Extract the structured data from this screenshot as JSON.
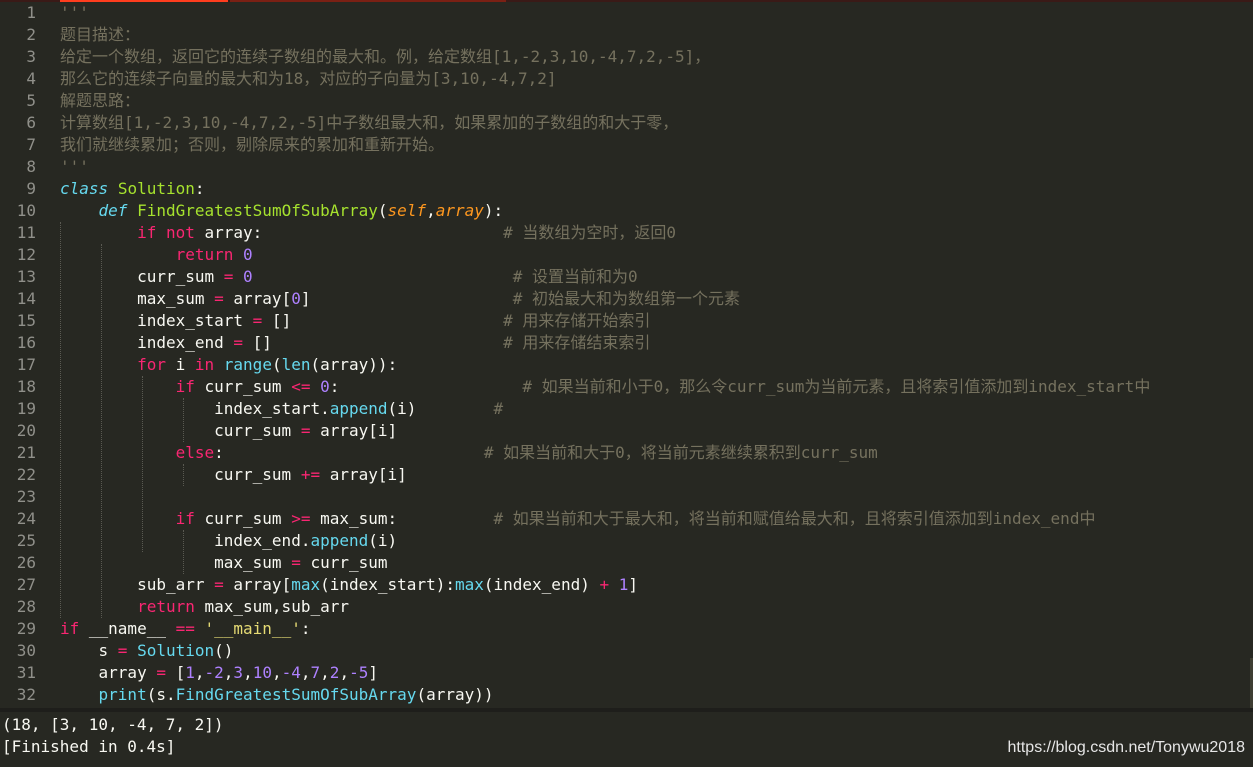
{
  "editor": {
    "lines": [
      {
        "n": "1",
        "tokens": [
          {
            "t": "'''",
            "c": "c-com"
          }
        ]
      },
      {
        "n": "2",
        "tokens": [
          {
            "t": "题目描述：",
            "c": "c-com"
          }
        ]
      },
      {
        "n": "3",
        "tokens": [
          {
            "t": "给定一个数组，返回它的连续子数组的最大和。例，给定数组[1,-2,3,10,-4,7,2,-5]，",
            "c": "c-com"
          }
        ]
      },
      {
        "n": "4",
        "tokens": [
          {
            "t": "那么它的连续子向量的最大和为18，对应的子向量为[3,10,-4,7,2]",
            "c": "c-com"
          }
        ]
      },
      {
        "n": "5",
        "tokens": [
          {
            "t": "解题思路：",
            "c": "c-com"
          }
        ]
      },
      {
        "n": "6",
        "tokens": [
          {
            "t": "计算数组[1,-2,3,10,-4,7,2,-5]中子数组最大和，如果累加的子数组的和大于零，",
            "c": "c-com"
          }
        ]
      },
      {
        "n": "7",
        "tokens": [
          {
            "t": "我们就继续累加；否则，剔除原来的累加和重新开始。",
            "c": "c-com"
          }
        ]
      },
      {
        "n": "8",
        "tokens": [
          {
            "t": "'''",
            "c": "c-com"
          }
        ]
      },
      {
        "n": "9",
        "tokens": [
          {
            "t": "class",
            "c": "c-st"
          },
          {
            "t": " "
          },
          {
            "t": "Solution",
            "c": "c-fn"
          },
          {
            "t": ":"
          }
        ]
      },
      {
        "n": "10",
        "tokens": [
          {
            "t": "    "
          },
          {
            "t": "def",
            "c": "c-st"
          },
          {
            "t": " "
          },
          {
            "t": "FindGreatestSumOfSubArray",
            "c": "c-fn"
          },
          {
            "t": "("
          },
          {
            "t": "self",
            "c": "c-pa"
          },
          {
            "t": ","
          },
          {
            "t": "array",
            "c": "c-pa"
          },
          {
            "t": "):"
          }
        ]
      },
      {
        "n": "11",
        "tokens": [
          {
            "t": "        "
          },
          {
            "t": "if",
            "c": "c-kw"
          },
          {
            "t": " "
          },
          {
            "t": "not",
            "c": "c-kw"
          },
          {
            "t": " array:                         "
          },
          {
            "t": "# 当数组为空时，返回0",
            "c": "c-com"
          }
        ]
      },
      {
        "n": "12",
        "tokens": [
          {
            "t": "            "
          },
          {
            "t": "return",
            "c": "c-kw"
          },
          {
            "t": " "
          },
          {
            "t": "0",
            "c": "c-nu"
          }
        ]
      },
      {
        "n": "13",
        "tokens": [
          {
            "t": "        curr_sum "
          },
          {
            "t": "=",
            "c": "c-kw"
          },
          {
            "t": " "
          },
          {
            "t": "0",
            "c": "c-nu"
          },
          {
            "t": "                           "
          },
          {
            "t": "# 设置当前和为0",
            "c": "c-com"
          }
        ]
      },
      {
        "n": "14",
        "tokens": [
          {
            "t": "        max_sum "
          },
          {
            "t": "=",
            "c": "c-kw"
          },
          {
            "t": " array["
          },
          {
            "t": "0",
            "c": "c-nu"
          },
          {
            "t": "]                     "
          },
          {
            "t": "# 初始最大和为数组第一个元素",
            "c": "c-com"
          }
        ]
      },
      {
        "n": "15",
        "tokens": [
          {
            "t": "        index_start "
          },
          {
            "t": "=",
            "c": "c-kw"
          },
          {
            "t": " []                      "
          },
          {
            "t": "# 用来存储开始索引",
            "c": "c-com"
          }
        ]
      },
      {
        "n": "16",
        "tokens": [
          {
            "t": "        index_end "
          },
          {
            "t": "=",
            "c": "c-kw"
          },
          {
            "t": " []                        "
          },
          {
            "t": "# 用来存储结束索引",
            "c": "c-com"
          }
        ]
      },
      {
        "n": "17",
        "tokens": [
          {
            "t": "        "
          },
          {
            "t": "for",
            "c": "c-kw"
          },
          {
            "t": " i "
          },
          {
            "t": "in",
            "c": "c-kw"
          },
          {
            "t": " "
          },
          {
            "t": "range",
            "c": "c-bi"
          },
          {
            "t": "("
          },
          {
            "t": "len",
            "c": "c-bi"
          },
          {
            "t": "(array)):"
          }
        ]
      },
      {
        "n": "18",
        "tokens": [
          {
            "t": "            "
          },
          {
            "t": "if",
            "c": "c-kw"
          },
          {
            "t": " curr_sum "
          },
          {
            "t": "<=",
            "c": "c-kw"
          },
          {
            "t": " "
          },
          {
            "t": "0",
            "c": "c-nu"
          },
          {
            "t": ":                   "
          },
          {
            "t": "# 如果当前和小于0，那么令curr_sum为当前元素，且将索引值添加到index_start中",
            "c": "c-com"
          }
        ]
      },
      {
        "n": "19",
        "tokens": [
          {
            "t": "                index_start."
          },
          {
            "t": "append",
            "c": "c-bi"
          },
          {
            "t": "(i)        "
          },
          {
            "t": "#",
            "c": "c-com"
          }
        ]
      },
      {
        "n": "20",
        "tokens": [
          {
            "t": "                curr_sum "
          },
          {
            "t": "=",
            "c": "c-kw"
          },
          {
            "t": " array[i]"
          }
        ]
      },
      {
        "n": "21",
        "tokens": [
          {
            "t": "            "
          },
          {
            "t": "else",
            "c": "c-kw"
          },
          {
            "t": ":                           "
          },
          {
            "t": "# 如果当前和大于0，将当前元素继续累积到curr_sum",
            "c": "c-com"
          }
        ]
      },
      {
        "n": "22",
        "tokens": [
          {
            "t": "                curr_sum "
          },
          {
            "t": "+=",
            "c": "c-kw"
          },
          {
            "t": " array[i]"
          }
        ]
      },
      {
        "n": "23",
        "tokens": []
      },
      {
        "n": "24",
        "tokens": [
          {
            "t": "            "
          },
          {
            "t": "if",
            "c": "c-kw"
          },
          {
            "t": " curr_sum "
          },
          {
            "t": ">=",
            "c": "c-kw"
          },
          {
            "t": " max_sum:          "
          },
          {
            "t": "# 如果当前和大于最大和，将当前和赋值给最大和，且将索引值添加到index_end中",
            "c": "c-com"
          }
        ]
      },
      {
        "n": "25",
        "tokens": [
          {
            "t": "                index_end."
          },
          {
            "t": "append",
            "c": "c-bi"
          },
          {
            "t": "(i)"
          }
        ]
      },
      {
        "n": "26",
        "tokens": [
          {
            "t": "                max_sum "
          },
          {
            "t": "=",
            "c": "c-kw"
          },
          {
            "t": " curr_sum"
          }
        ]
      },
      {
        "n": "27",
        "tokens": [
          {
            "t": "        sub_arr "
          },
          {
            "t": "=",
            "c": "c-kw"
          },
          {
            "t": " array["
          },
          {
            "t": "max",
            "c": "c-bi"
          },
          {
            "t": "(index_start):"
          },
          {
            "t": "max",
            "c": "c-bi"
          },
          {
            "t": "(index_end) "
          },
          {
            "t": "+",
            "c": "c-kw"
          },
          {
            "t": " "
          },
          {
            "t": "1",
            "c": "c-nu"
          },
          {
            "t": "]"
          }
        ]
      },
      {
        "n": "28",
        "tokens": [
          {
            "t": "        "
          },
          {
            "t": "return",
            "c": "c-kw"
          },
          {
            "t": " max_sum,sub_arr"
          }
        ]
      },
      {
        "n": "29",
        "tokens": [
          {
            "t": "if",
            "c": "c-kw"
          },
          {
            "t": " __name__ "
          },
          {
            "t": "==",
            "c": "c-kw"
          },
          {
            "t": " "
          },
          {
            "t": "'__main__'",
            "c": "c-s"
          },
          {
            "t": ":"
          }
        ]
      },
      {
        "n": "30",
        "tokens": [
          {
            "t": "    s "
          },
          {
            "t": "=",
            "c": "c-kw"
          },
          {
            "t": " "
          },
          {
            "t": "Solution",
            "c": "c-bi"
          },
          {
            "t": "()"
          }
        ]
      },
      {
        "n": "31",
        "tokens": [
          {
            "t": "    array "
          },
          {
            "t": "=",
            "c": "c-kw"
          },
          {
            "t": " ["
          },
          {
            "t": "1",
            "c": "c-nu"
          },
          {
            "t": ","
          },
          {
            "t": "-2",
            "c": "c-nu"
          },
          {
            "t": ","
          },
          {
            "t": "3",
            "c": "c-nu"
          },
          {
            "t": ","
          },
          {
            "t": "10",
            "c": "c-nu"
          },
          {
            "t": ","
          },
          {
            "t": "-4",
            "c": "c-nu"
          },
          {
            "t": ","
          },
          {
            "t": "7",
            "c": "c-nu"
          },
          {
            "t": ","
          },
          {
            "t": "2",
            "c": "c-nu"
          },
          {
            "t": ","
          },
          {
            "t": "-5",
            "c": "c-nu"
          },
          {
            "t": "]"
          }
        ]
      },
      {
        "n": "32",
        "tokens": [
          {
            "t": "    "
          },
          {
            "t": "print",
            "c": "c-bi"
          },
          {
            "t": "(s."
          },
          {
            "t": "FindGreatestSumOfSubArray",
            "c": "c-bi"
          },
          {
            "t": "(array))"
          }
        ]
      }
    ]
  },
  "console": {
    "output": "(18, [3, 10, -4, 7, 2])",
    "status": "[Finished in 0.4s]"
  },
  "watermark": "https://blog.csdn.net/Tonywu2018",
  "colors": {
    "background": "#272822",
    "keyword": "#f92672",
    "storage": "#66d9ef",
    "function": "#a6e22e",
    "parameter": "#fd971f",
    "number": "#ae81ff",
    "string": "#e6db74",
    "comment": "#75715e",
    "tab_accent": "#ff3d1e"
  }
}
